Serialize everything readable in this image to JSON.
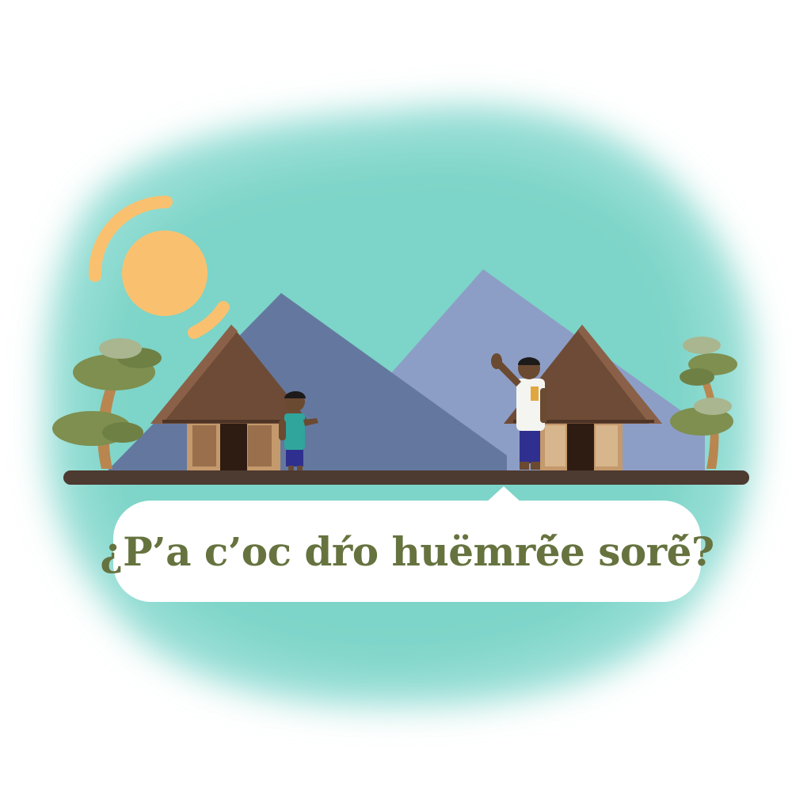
{
  "speech_bubble": {
    "text": "¿P’a c’oc dŕo huëmrẽ́e sorẽ́?"
  },
  "colors": {
    "watercolor_bg": "#7fd6cb",
    "sun": "#f9c16f",
    "mountain_back": "#8d9ec6",
    "mountain_front": "#64789f",
    "hut_roof": "#6e4b36",
    "hut_wall": "#c4996c",
    "ground": "#4d3a30",
    "tree_foliage": "#7e8f4f",
    "text": "#66733f"
  },
  "scene": {
    "elements": [
      "sun-icon",
      "mountain-icon",
      "hut-icon",
      "tree-icon",
      "child-figure",
      "man-figure",
      "ground-line"
    ]
  }
}
